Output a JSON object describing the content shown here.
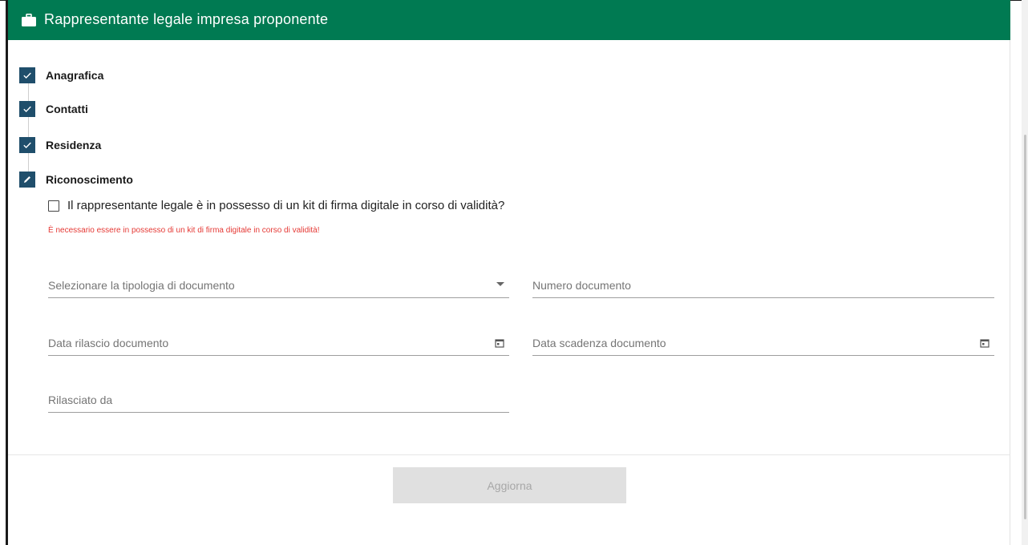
{
  "header": {
    "title": "Rappresentante legale impresa proponente",
    "icon": "briefcase-icon",
    "background": "#007a52"
  },
  "steps": [
    {
      "label": "Anagrafica",
      "state": "completed",
      "icon": "check-icon"
    },
    {
      "label": "Contatti",
      "state": "completed",
      "icon": "check-icon"
    },
    {
      "label": "Residenza",
      "state": "completed",
      "icon": "check-icon"
    },
    {
      "label": "Riconoscimento",
      "state": "editing",
      "icon": "pencil-icon"
    }
  ],
  "step_badge_color": "#1f4e6b",
  "form": {
    "digital_signature_checkbox": {
      "label": "Il rappresentante legale è in possesso di un kit di firma digitale in corso di validità?",
      "checked": false
    },
    "error_message": "È necessario essere in possesso di un kit di firma digitale in corso di validità!",
    "error_color": "#e53935",
    "fields": {
      "document_type": {
        "placeholder": "Selezionare la tipologia di documento",
        "icon": "dropdown-arrow-icon"
      },
      "document_number": {
        "placeholder": "Numero documento"
      },
      "issue_date": {
        "placeholder": "Data rilascio documento",
        "icon": "calendar-icon"
      },
      "expiry_date": {
        "placeholder": "Data scadenza documento",
        "icon": "calendar-icon"
      },
      "issued_by": {
        "placeholder": "Rilasciato da"
      }
    }
  },
  "actions": {
    "update_label": "Aggiorna",
    "update_disabled": true
  }
}
